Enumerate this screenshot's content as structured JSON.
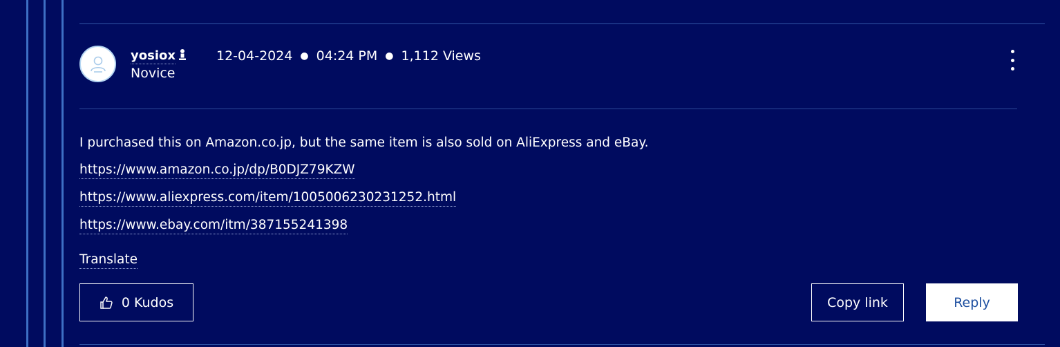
{
  "post": {
    "author": {
      "username": "yosiox",
      "rank": "Novice"
    },
    "date": "12-04-2024",
    "time": "04:24 PM",
    "views": "1,112 Views",
    "body": "I purchased this on Amazon.co.jp, but the same item is also sold on AliExpress and eBay.",
    "links": [
      "https://www.amazon.co.jp/dp/B0DJZ79KZW",
      "https://www.aliexpress.com/item/1005006230231252.html",
      "https://www.ebay.com/itm/387155241398"
    ],
    "translate_label": "Translate"
  },
  "actions": {
    "kudos_label": "0 Kudos",
    "copy_link_label": "Copy link",
    "reply_label": "Reply"
  },
  "icons": {
    "avatar": "default-user-avatar-icon",
    "rank": "user-rank-icon",
    "menu": "kebab-menu-icon",
    "kudos": "thumbs-up-icon"
  },
  "colors": {
    "background": "#000b5f",
    "thread_line": "#3d6fc4",
    "reply_text": "#1d4fa0"
  }
}
